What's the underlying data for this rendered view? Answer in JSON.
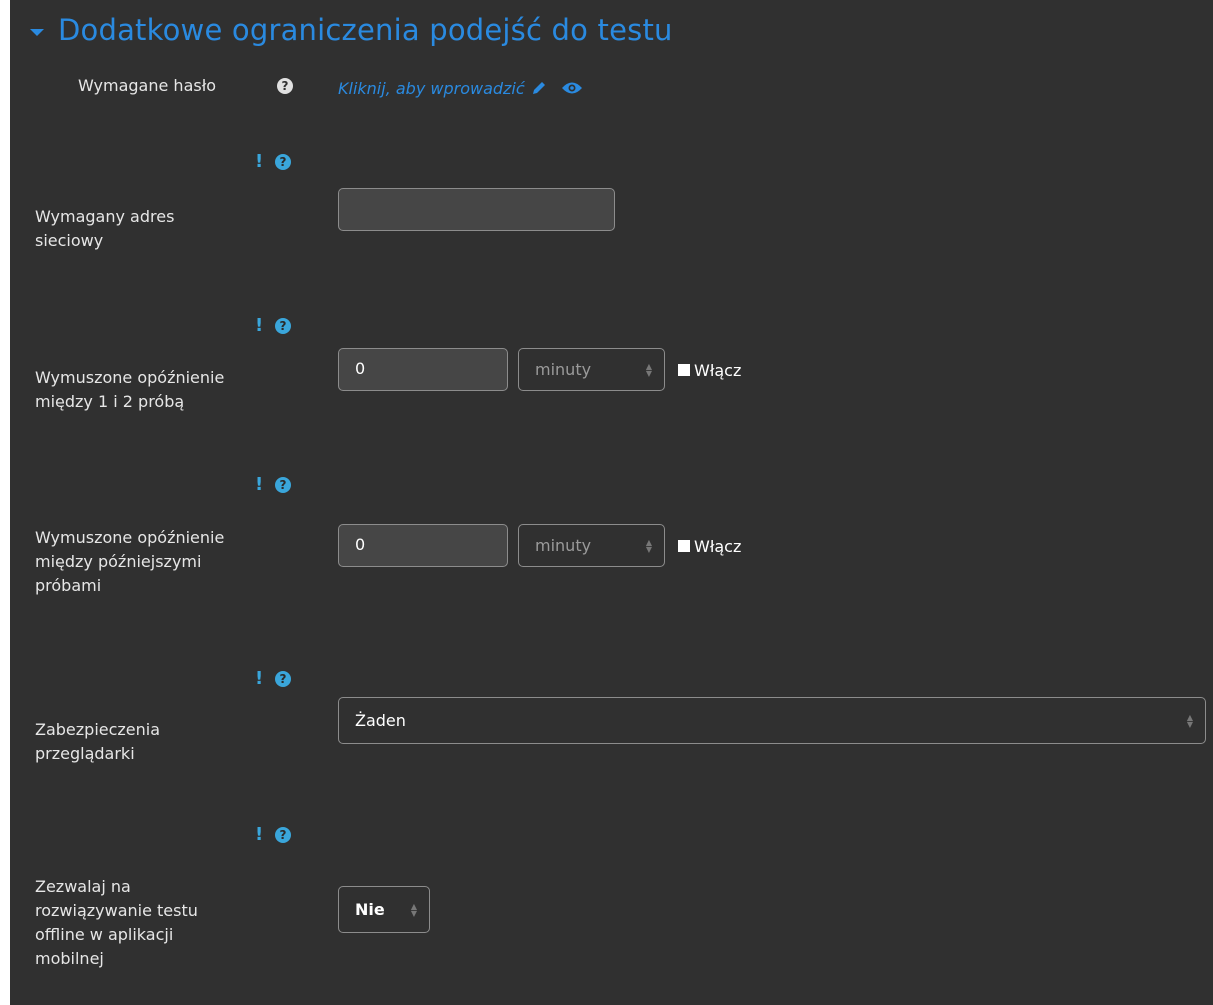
{
  "section": {
    "title": "Dodatkowe ograniczenia podejść do testu"
  },
  "password": {
    "label": "Wymagane hasło",
    "edit_link": "Kliknij, aby wprowadzić"
  },
  "network": {
    "label_line1": "Wymagany adres",
    "label_line2": "sieciowy",
    "value": ""
  },
  "delay1": {
    "label_line1": "Wymuszone opóźnienie",
    "label_line2": "między 1 i 2 próbą",
    "value": "0",
    "unit": "minuty",
    "enable_label": "Włącz"
  },
  "delay2": {
    "label_line1": "Wymuszone opóźnienie",
    "label_line2": "między późniejszymi",
    "label_line3": "próbami",
    "value": "0",
    "unit": "minuty",
    "enable_label": "Włącz"
  },
  "browser_security": {
    "label_line1": "Zabezpieczenia",
    "label_line2": "przeglądarki",
    "selected": "Żaden"
  },
  "offline": {
    "label_line1": "Zezwalaj na",
    "label_line2": "rozwiązywanie testu",
    "label_line3": "offline w aplikacji",
    "label_line4": "mobilnej",
    "selected": "Nie"
  },
  "icons": {
    "help": "?",
    "warning": "!"
  },
  "colors": {
    "background": "#303030",
    "link_blue": "#2a8ae0",
    "help_blue": "#3aa6db",
    "text": "#e6e6e6"
  }
}
